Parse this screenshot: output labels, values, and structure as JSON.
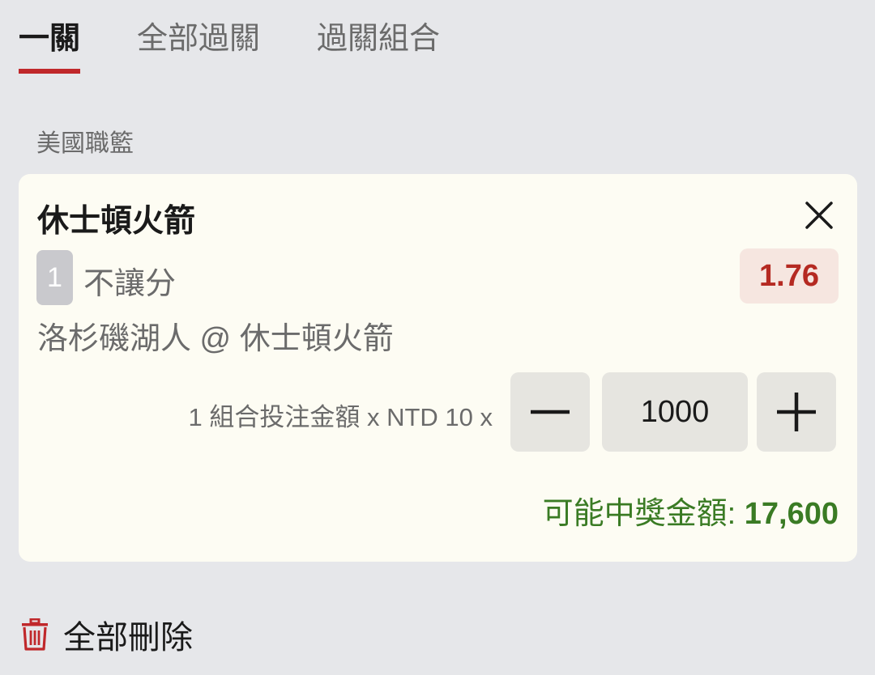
{
  "tabs": [
    {
      "label": "一關",
      "active": true
    },
    {
      "label": "全部過關",
      "active": false
    },
    {
      "label": "過關組合",
      "active": false
    }
  ],
  "league": "美國職籃",
  "bet": {
    "team": "休士頓火箭",
    "badge": "1",
    "market": "不讓分",
    "odds": "1.76",
    "match": "洛杉磯湖人 @ 休士頓火箭",
    "stake_label": "1 組合投注金額 x NTD 10 x",
    "stake_value": "1000",
    "payout_label": "可能中獎金額: ",
    "payout_amount": "17,600"
  },
  "footer": {
    "delete_all_label": "全部刪除"
  },
  "colors": {
    "accent_red": "#c0282b",
    "odds_red": "#b52a22",
    "payout_green": "#3a7b24",
    "background": "#e6e7ea",
    "card": "#fdfcf3"
  },
  "icons": {
    "close": "close-icon",
    "minus": "minus-icon",
    "plus": "plus-icon",
    "delete": "trash-icon"
  }
}
